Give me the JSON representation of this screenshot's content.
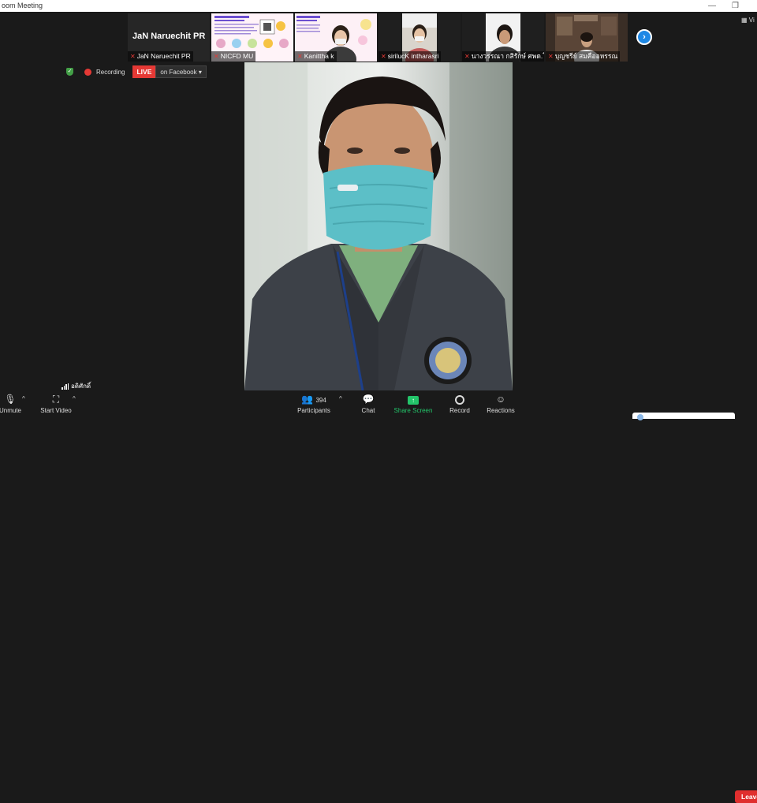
{
  "window": {
    "title": "oom Meeting"
  },
  "participants_strip": [
    {
      "id": "p1",
      "display_name": "JaN Naruechit PR",
      "label": "JaN Naruechit PR",
      "muted": true
    },
    {
      "id": "p2",
      "label": "NICFD MU",
      "muted": true
    },
    {
      "id": "p3",
      "label": "Kanittha k",
      "muted": true
    },
    {
      "id": "p4",
      "label": "sirilucK intharasri",
      "muted": true
    },
    {
      "id": "p5",
      "label": "นางวรรณา กสิรักษ์ ศพด.โ...",
      "muted": true
    },
    {
      "id": "p6",
      "label": "บุญชรีย์ สมคืออหรรณ",
      "muted": true
    }
  ],
  "status": {
    "recording_label": "Recording",
    "live_label": "LIVE",
    "live_target": "on Facebook",
    "dropdown_icon": "caret-down-icon"
  },
  "view_toggle": {
    "label": "Vi"
  },
  "active_speaker": {
    "name": "อดิศักดิ์",
    "audio_icon": "signal-bars-icon"
  },
  "toolbar": {
    "unmute_label": "Unmute",
    "start_video_label": "Start Video",
    "participants_label": "Participants",
    "participants_count": "394",
    "chat_label": "Chat",
    "share_screen_label": "Share Screen",
    "record_label": "Record",
    "reactions_label": "Reactions",
    "leave_label": "Leave"
  },
  "colors": {
    "background": "#1a1a1a",
    "live_red": "#e53935",
    "share_green": "#23c56a",
    "next_blue": "#1e88e5",
    "leave_red": "#e02e2e"
  }
}
